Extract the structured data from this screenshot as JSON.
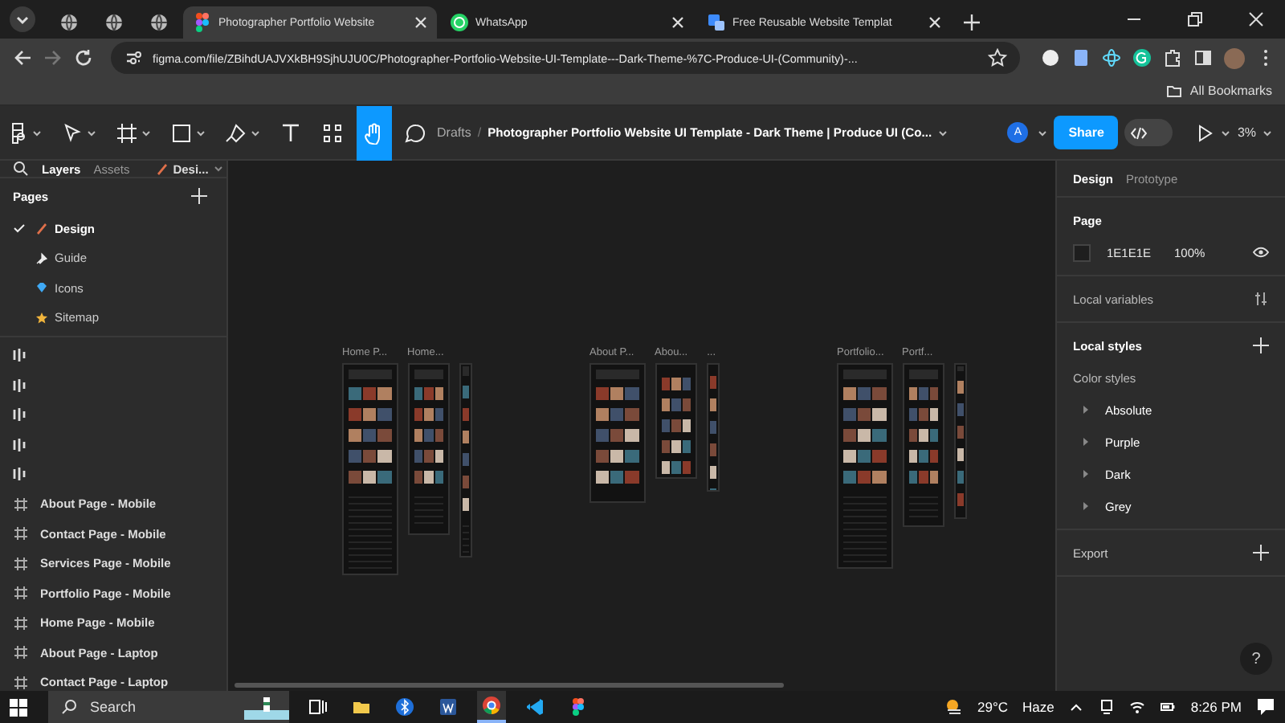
{
  "browser": {
    "tabs": [
      {
        "kind": "pinned",
        "selected": false
      },
      {
        "kind": "pinned",
        "selected": false
      },
      {
        "kind": "pinned",
        "selected": false
      },
      {
        "kind": "figma",
        "label": "Photographer Portfolio Website",
        "selected": true
      },
      {
        "kind": "whatsapp",
        "label": "WhatsApp",
        "selected": false
      },
      {
        "kind": "template",
        "label": "Free Reusable Website Templat",
        "selected": false
      }
    ],
    "url": "figma.com/file/ZBihdUAJVXkBH9SjhUJU0C/Photographer-Portfolio-Website-UI-Template---Dark-Theme-%7C-Produce-UI-(Community)-...",
    "bookmarks": "All Bookmarks"
  },
  "toolbar": {
    "tools": [
      {
        "kind": "menu",
        "selected": false
      },
      {
        "kind": "move",
        "selected": false
      },
      {
        "kind": "frame",
        "selected": false
      },
      {
        "kind": "shape",
        "selected": false
      },
      {
        "kind": "pen",
        "selected": false
      },
      {
        "kind": "text",
        "selected": false
      },
      {
        "kind": "resources",
        "selected": false
      },
      {
        "kind": "hand",
        "selected": true
      },
      {
        "kind": "comment",
        "selected": false
      }
    ],
    "breadcrumb": "Drafts",
    "separator": "/",
    "title": "Photographer Portfolio Website UI Template - Dark Theme | Produce UI (Co...",
    "avatar": "A",
    "share": "Share",
    "dev_mode": {
      "on": false
    },
    "zoom": "3%"
  },
  "layers_panel": {
    "tabs": [
      {
        "label": "Layers",
        "selected": true
      },
      {
        "label": "Assets",
        "selected": false
      }
    ],
    "page_menu": "Desi...",
    "pages_heading": "Pages",
    "pages": [
      {
        "kind": "brush",
        "label": "Design",
        "selected": true
      },
      {
        "kind": "pin",
        "label": "Guide",
        "selected": false
      },
      {
        "kind": "gem",
        "label": "Icons",
        "selected": false
      },
      {
        "kind": "star",
        "label": "Sitemap",
        "selected": false
      }
    ],
    "layers": [
      {
        "kind": "section"
      },
      {
        "kind": "section"
      },
      {
        "kind": "section"
      },
      {
        "kind": "section"
      },
      {
        "kind": "section"
      },
      {
        "kind": "frame",
        "label": "About Page - Mobile"
      },
      {
        "kind": "frame",
        "label": "Contact Page - Mobile"
      },
      {
        "kind": "frame",
        "label": "Services Page - Mobile"
      },
      {
        "kind": "frame",
        "label": "Portfolio Page - Mobile"
      },
      {
        "kind": "frame",
        "label": "Home Page - Mobile"
      },
      {
        "kind": "frame",
        "label": "About Page - Laptop"
      },
      {
        "kind": "frame",
        "label": "Contact Page - Laptop"
      }
    ]
  },
  "canvas": {
    "groups": [
      {
        "frames": [
          {
            "kind": "desktop",
            "label": "Home P..."
          },
          {
            "kind": "tablet",
            "label": "Home..."
          },
          {
            "kind": "mobile"
          }
        ]
      },
      {
        "frames": [
          {
            "kind": "desktop",
            "label": "About P..."
          },
          {
            "kind": "tablet",
            "label": "Abou..."
          },
          {
            "kind": "mobile",
            "label": "..."
          }
        ]
      },
      {
        "frames": [
          {
            "kind": "desktop",
            "label": "Portfolio..."
          },
          {
            "kind": "tablet",
            "label": "Portf..."
          },
          {
            "kind": "mobile"
          }
        ]
      }
    ]
  },
  "design_panel": {
    "tabs": [
      {
        "label": "Design",
        "selected": true
      },
      {
        "label": "Prototype",
        "selected": false
      }
    ],
    "page_heading": "Page",
    "fill_hex": "1E1E1E",
    "fill_opacity": "100%",
    "local_variables": "Local variables",
    "local_styles": "Local styles",
    "color_styles": "Color styles",
    "styles": [
      "Absolute",
      "Purple",
      "Dark",
      "Grey"
    ],
    "export": "Export",
    "help": "?"
  },
  "taskbar": {
    "search": "Search",
    "apps": [
      {
        "kind": "task-view",
        "selected": false
      },
      {
        "kind": "explorer",
        "selected": false
      },
      {
        "kind": "bluetooth",
        "selected": false
      },
      {
        "kind": "word",
        "selected": false
      },
      {
        "kind": "chrome",
        "selected": true
      },
      {
        "kind": "vscode",
        "selected": false
      },
      {
        "kind": "figma",
        "selected": false
      }
    ],
    "temperature": "29°C",
    "weather": "Haze",
    "time": "8:26 PM"
  }
}
